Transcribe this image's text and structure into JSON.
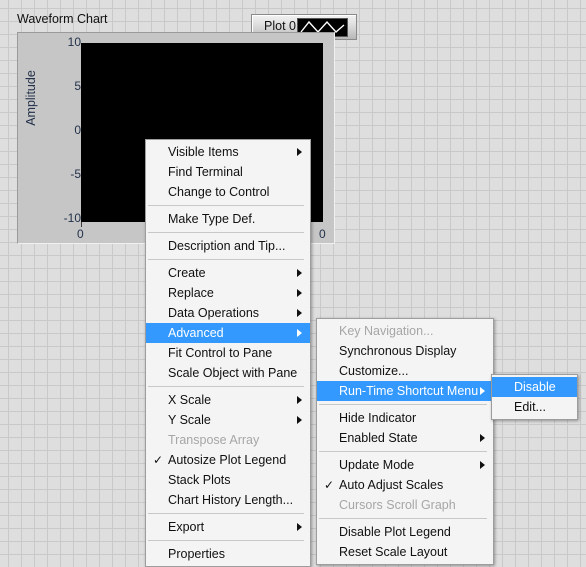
{
  "chart": {
    "title": "Waveform Chart",
    "legend": {
      "label": "Plot 0",
      "swatch_icon": "waveform-line-icon"
    },
    "y_axis": {
      "label": "Amplitude",
      "ticks": [
        "10",
        "5",
        "0",
        "-5",
        "-10"
      ]
    },
    "x_axis": {
      "label": "",
      "ticks": [
        "0"
      ],
      "right_tick": "0"
    }
  },
  "menu_main": {
    "items": [
      {
        "label": "Visible Items",
        "submenu": true,
        "checked": false,
        "disabled": false,
        "selected": false
      },
      {
        "label": "Find Terminal",
        "submenu": false,
        "checked": false,
        "disabled": false,
        "selected": false
      },
      {
        "label": "Change to Control",
        "submenu": false,
        "checked": false,
        "disabled": false,
        "selected": false
      },
      {
        "separator": true
      },
      {
        "label": "Make Type Def.",
        "submenu": false,
        "checked": false,
        "disabled": false,
        "selected": false
      },
      {
        "separator": true
      },
      {
        "label": "Description and Tip...",
        "submenu": false,
        "checked": false,
        "disabled": false,
        "selected": false
      },
      {
        "separator": true
      },
      {
        "label": "Create",
        "submenu": true,
        "checked": false,
        "disabled": false,
        "selected": false
      },
      {
        "label": "Replace",
        "submenu": true,
        "checked": false,
        "disabled": false,
        "selected": false
      },
      {
        "label": "Data Operations",
        "submenu": true,
        "checked": false,
        "disabled": false,
        "selected": false
      },
      {
        "label": "Advanced",
        "submenu": true,
        "checked": false,
        "disabled": false,
        "selected": true
      },
      {
        "label": "Fit Control to Pane",
        "submenu": false,
        "checked": false,
        "disabled": false,
        "selected": false
      },
      {
        "label": "Scale Object with Pane",
        "submenu": false,
        "checked": false,
        "disabled": false,
        "selected": false
      },
      {
        "separator": true
      },
      {
        "label": "X Scale",
        "submenu": true,
        "checked": false,
        "disabled": false,
        "selected": false
      },
      {
        "label": "Y Scale",
        "submenu": true,
        "checked": false,
        "disabled": false,
        "selected": false
      },
      {
        "label": "Transpose Array",
        "submenu": false,
        "checked": false,
        "disabled": true,
        "selected": false
      },
      {
        "label": "Autosize Plot Legend",
        "submenu": false,
        "checked": true,
        "disabled": false,
        "selected": false
      },
      {
        "label": "Stack Plots",
        "submenu": false,
        "checked": false,
        "disabled": false,
        "selected": false
      },
      {
        "label": "Chart History Length...",
        "submenu": false,
        "checked": false,
        "disabled": false,
        "selected": false
      },
      {
        "separator": true
      },
      {
        "label": "Export",
        "submenu": true,
        "checked": false,
        "disabled": false,
        "selected": false
      },
      {
        "separator": true
      },
      {
        "label": "Properties",
        "submenu": false,
        "checked": false,
        "disabled": false,
        "selected": false
      }
    ]
  },
  "menu_advanced": {
    "items": [
      {
        "label": "Key Navigation...",
        "submenu": false,
        "checked": false,
        "disabled": true,
        "selected": false
      },
      {
        "label": "Synchronous Display",
        "submenu": false,
        "checked": false,
        "disabled": false,
        "selected": false
      },
      {
        "label": "Customize...",
        "submenu": false,
        "checked": false,
        "disabled": false,
        "selected": false
      },
      {
        "label": "Run-Time Shortcut Menu",
        "submenu": true,
        "checked": false,
        "disabled": false,
        "selected": true
      },
      {
        "separator": true
      },
      {
        "label": "Hide Indicator",
        "submenu": false,
        "checked": false,
        "disabled": false,
        "selected": false
      },
      {
        "label": "Enabled State",
        "submenu": true,
        "checked": false,
        "disabled": false,
        "selected": false
      },
      {
        "separator": true
      },
      {
        "label": "Update Mode",
        "submenu": true,
        "checked": false,
        "disabled": false,
        "selected": false
      },
      {
        "label": "Auto Adjust Scales",
        "submenu": false,
        "checked": true,
        "disabled": false,
        "selected": false
      },
      {
        "label": "Cursors Scroll Graph",
        "submenu": false,
        "checked": false,
        "disabled": true,
        "selected": false
      },
      {
        "separator": true
      },
      {
        "label": "Disable Plot Legend",
        "submenu": false,
        "checked": false,
        "disabled": false,
        "selected": false
      },
      {
        "label": "Reset Scale Layout",
        "submenu": false,
        "checked": false,
        "disabled": false,
        "selected": false
      }
    ]
  },
  "menu_runtime": {
    "items": [
      {
        "label": "Disable",
        "submenu": false,
        "checked": false,
        "disabled": false,
        "selected": true
      },
      {
        "label": "Edit...",
        "submenu": false,
        "checked": false,
        "disabled": false,
        "selected": false
      }
    ]
  },
  "colors": {
    "highlight": "#3399ff",
    "highlight_text": "#ffffff",
    "menu_background": "#f4f4f4",
    "plot_background": "#000000",
    "panel_background": "#dedede",
    "axis_text": "#24324a"
  }
}
